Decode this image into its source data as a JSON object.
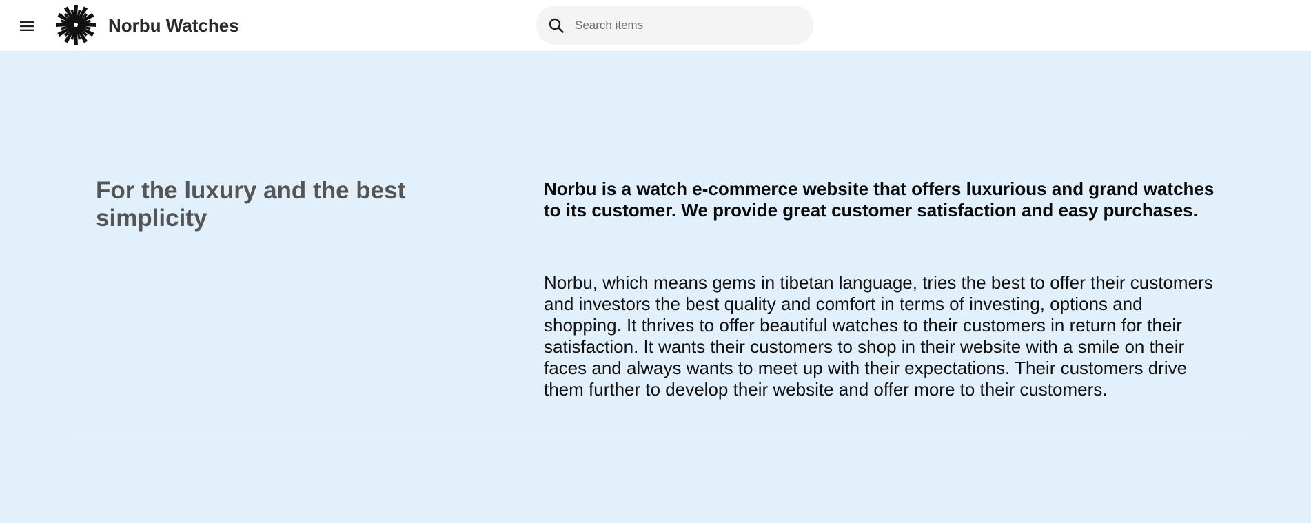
{
  "header": {
    "menu_icon": "hamburger-menu-icon",
    "logo_icon": "starburst-logo-icon",
    "brand_name": "Norbu Watches",
    "search": {
      "icon": "search-icon",
      "placeholder": "Search items",
      "value": ""
    }
  },
  "hero": {
    "headline": "For the luxury and the best simplicity",
    "lead": "Norbu is a watch e-commerce website that offers luxurious and grand watches to its customer. We provide great customer satisfaction and easy purchases.",
    "body": "Norbu, which means gems in tibetan language, tries the best to offer their customers and investors the best quality and comfort in terms of investing, options and shopping. It thrives to offer beautiful watches to their customers in return for their satisfaction. It wants their customers to shop in their website with a smile on their faces and always wants to meet up with their expectations. Their customers drive them further to develop their website and offer more to their customers."
  },
  "colors": {
    "hero_background": "#e2f0fb",
    "headline": "#555555",
    "header_background": "#ffffff",
    "search_background": "#f4f4f4"
  }
}
